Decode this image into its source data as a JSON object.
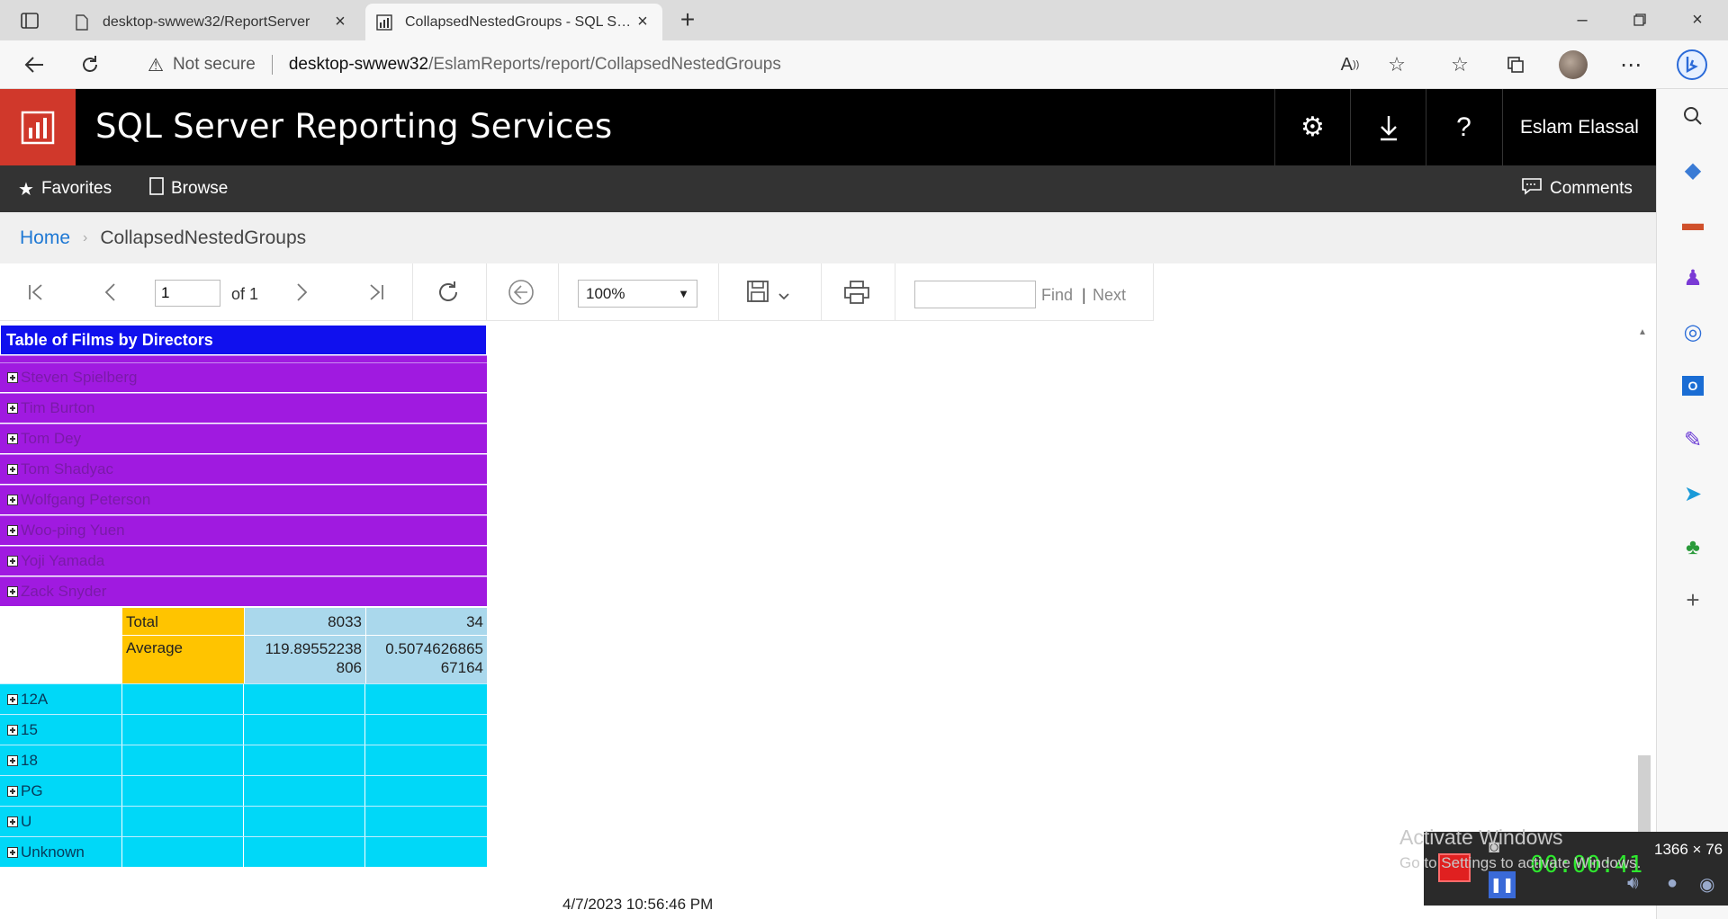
{
  "browser": {
    "tabs": [
      {
        "title": "desktop-swwew32/ReportServer",
        "active": false
      },
      {
        "title": "CollapsedNestedGroups - SQL Server Reporting Services",
        "active": true
      }
    ],
    "url_warning": "Not secure",
    "url_host": "desktop-swwew32",
    "url_path": "/EslamReports/report/CollapsedNestedGroups",
    "read_aloud_label": "A"
  },
  "ssrs": {
    "app_title": "SQL Server Reporting Services",
    "user_name": "Eslam Elassal",
    "nav": {
      "favorites": "Favorites",
      "browse": "Browse",
      "comments": "Comments"
    },
    "breadcrumb": {
      "home": "Home",
      "current": "CollapsedNestedGroups"
    },
    "colors": {
      "header_bg": "#000000",
      "logo_bg": "#d0382b",
      "nav_bg": "#333333",
      "link": "#1e78d4"
    }
  },
  "toolbar": {
    "page_value": "1",
    "of_label": "of 1",
    "zoom": "100%",
    "find_label": "Find",
    "next_label": "Next",
    "find_placeholder": ""
  },
  "report": {
    "title": "Table of Films by Directors",
    "directors": [
      "Steven Spielberg",
      "Tim Burton",
      "Tom Dey",
      "Tom Shadyac",
      "Wolfgang Peterson",
      "Woo-ping Yuen",
      "Yoji Yamada",
      "Zack Snyder"
    ],
    "total": {
      "label": "Total",
      "value1": "8033",
      "value2": "34"
    },
    "average": {
      "label": "Average",
      "value1_line1": "119.89552238",
      "value1_line2": "806",
      "value2_line1": "0.5074626865",
      "value2_line2": "67164"
    },
    "certificates": [
      "12A",
      "15",
      "18",
      "PG",
      "U",
      "Unknown"
    ],
    "timestamp": "4/7/2023 10:56:46 PM",
    "colors": {
      "title_bg": "#1010ee",
      "director_bg": "#a01ae0",
      "label_bg": "#ffc400",
      "value_bg": "#aad8ec",
      "certificate_bg": "#00d8f8"
    }
  },
  "overlay": {
    "watermark_line1": "Activate Windows",
    "watermark_line2": "Go to Settings to activate Windows.",
    "recorder_time": "00:00:41",
    "recorder_resolution": "1366 × 76"
  }
}
